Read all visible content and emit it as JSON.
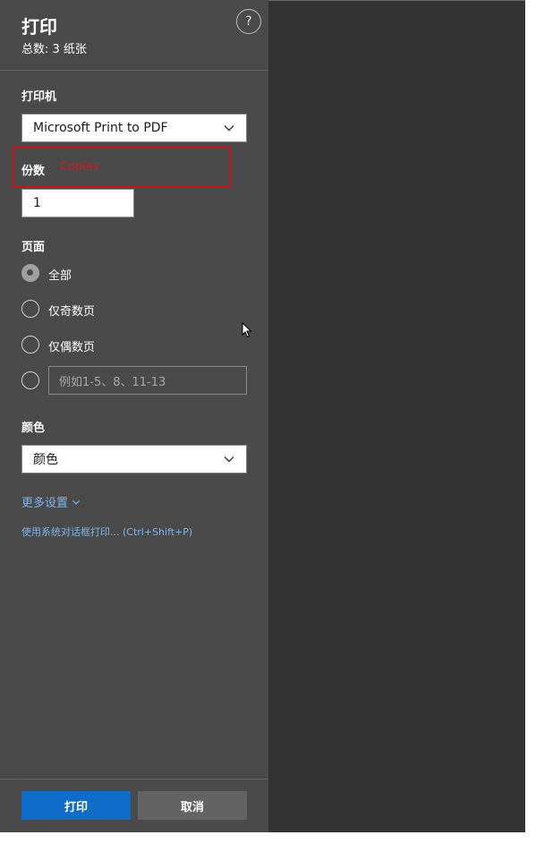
{
  "header": {
    "title": "打印",
    "sheet_count": "总数: 3 纸张",
    "help": "?"
  },
  "printer": {
    "label": "打印机",
    "selected": "Microsoft Print to PDF"
  },
  "copies": {
    "label": "份数",
    "annotation": "Copies",
    "value": "1"
  },
  "pages": {
    "label": "页面",
    "options": [
      "全部",
      "仅奇数页",
      "仅偶数页"
    ],
    "selected_index": 0,
    "custom_placeholder": "例如1-5、8、11-13"
  },
  "color": {
    "label": "颜色",
    "selected": "颜色"
  },
  "links": {
    "more_settings": "更多设置",
    "system_dialog": "使用系统对话框打印... (Ctrl+Shift+P)"
  },
  "buttons": {
    "print": "打印",
    "cancel": "取消"
  },
  "colors": {
    "panel_bg": "#4a4a4a",
    "preview_bg": "#333333",
    "primary": "#0f6cc8",
    "link": "#7fb5e8",
    "highlight": "#c0161c"
  }
}
